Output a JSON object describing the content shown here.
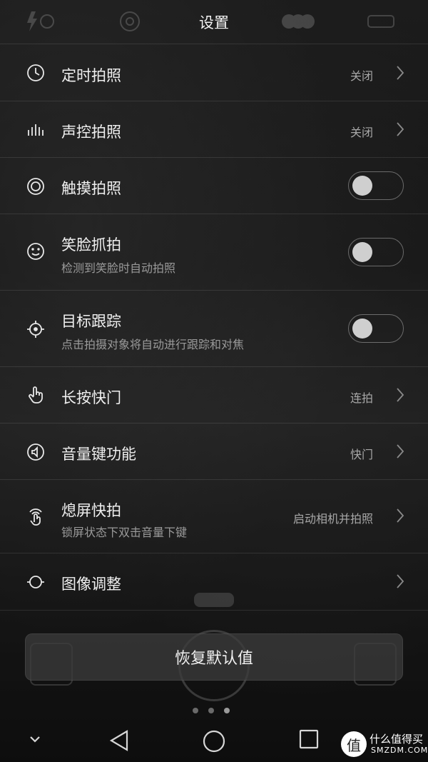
{
  "header": {
    "title": "设置"
  },
  "settings": [
    {
      "icon": "clock-icon",
      "label": "定时拍照",
      "value": "关闭",
      "control": "chevron"
    },
    {
      "icon": "sound-bars-icon",
      "label": "声控拍照",
      "value": "关闭",
      "control": "chevron"
    },
    {
      "icon": "target-circle-icon",
      "label": "触摸拍照",
      "control": "toggle",
      "enabled": false
    },
    {
      "icon": "smile-icon",
      "label": "笑脸抓拍",
      "sub": "检测到笑脸时自动拍照",
      "control": "toggle",
      "enabled": false
    },
    {
      "icon": "crosshair-icon",
      "label": "目标跟踪",
      "sub": "点击拍摄对象将自动进行跟踪和对焦",
      "control": "toggle",
      "enabled": false
    },
    {
      "icon": "hand-press-icon",
      "label": "长按快门",
      "value": "连拍",
      "control": "chevron"
    },
    {
      "icon": "volume-key-icon",
      "label": "音量键功能",
      "value": "快门",
      "control": "chevron"
    },
    {
      "icon": "touch-wave-icon",
      "label": "熄屏快拍",
      "sub": "锁屏状态下双击音量下键",
      "value": "启动相机并拍照",
      "control": "chevron"
    },
    {
      "icon": "adjust-icon",
      "label": "图像调整",
      "control": "chevron"
    }
  ],
  "reset_button": {
    "label": "恢复默认值"
  },
  "watermark": {
    "badge": "值",
    "main": "什么值得买",
    "sub": "SMZDM.COM"
  }
}
